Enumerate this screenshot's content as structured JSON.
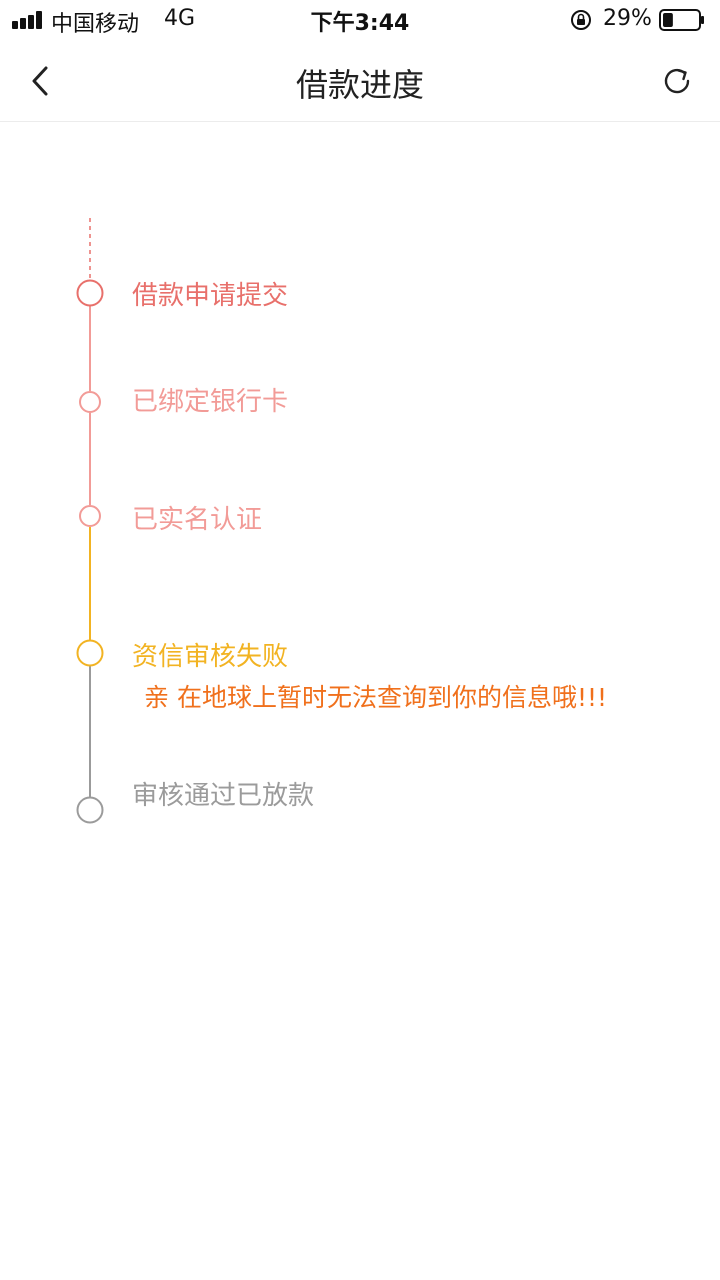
{
  "status_bar": {
    "carrier": "中国移动",
    "network": "4G",
    "time": "下午3:44",
    "battery_percent": "29%",
    "battery_level": 0.29
  },
  "nav": {
    "title": "借款进度",
    "back_icon": "chevron-left-icon",
    "refresh_icon": "refresh-icon"
  },
  "timeline": {
    "steps": [
      {
        "label": "借款申请提交",
        "color": "#e8706b",
        "state": "done"
      },
      {
        "label": "已绑定银行卡",
        "color": "#f29b97",
        "state": "done"
      },
      {
        "label": "已实名认证",
        "color": "#f29b97",
        "state": "done"
      },
      {
        "label": "资信审核失败",
        "color": "#f2b322",
        "state": "current"
      },
      {
        "label": "审核通过已放款",
        "color": "#9b9b9b",
        "state": "pending"
      }
    ],
    "failure_message": "亲 在地球上暂时无法查询到你的信息哦!!!"
  }
}
